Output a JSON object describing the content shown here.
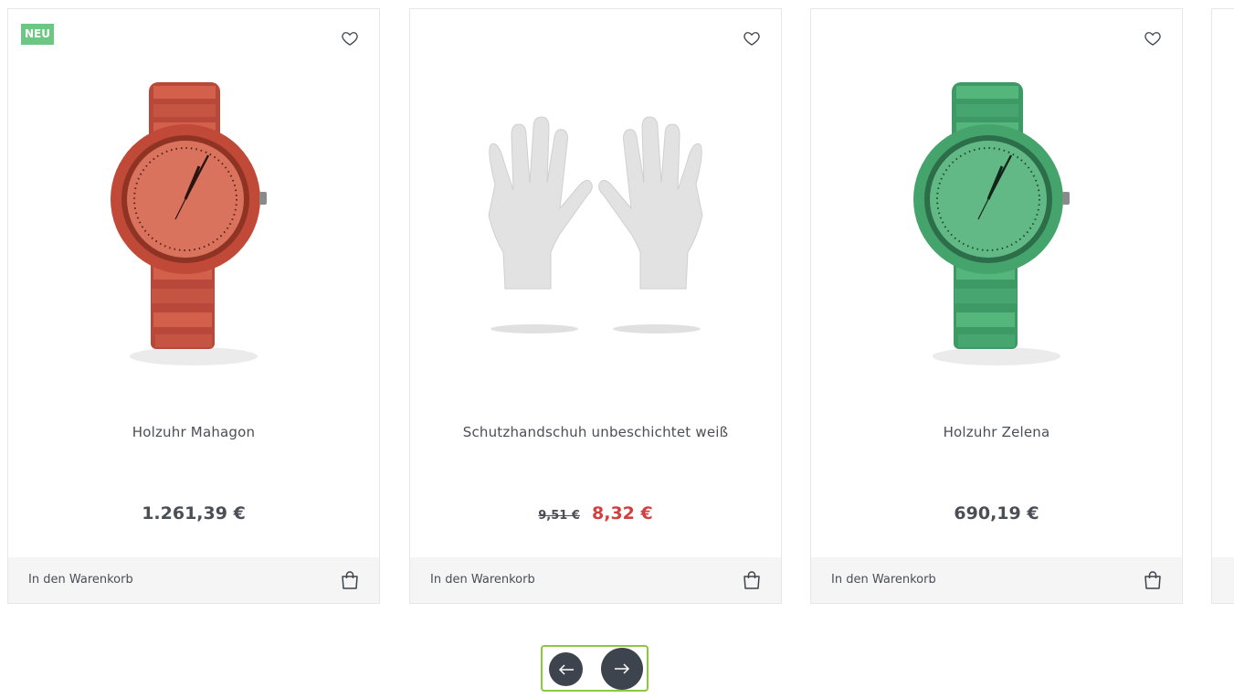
{
  "products": [
    {
      "badge": "NEU",
      "name": "Holzuhr Mahagon",
      "price": "1.261,39 €",
      "cart_label": "In den Warenkorb",
      "image": "watch-mahogany",
      "color": "#c8573f"
    },
    {
      "name": "Schutzhandschuh unbeschichtet weiß",
      "old_price": "9,51 €",
      "sale_price": "8,32 €",
      "cart_label": "In den Warenkorb",
      "image": "white-gloves",
      "color": "#e5e5e5"
    },
    {
      "name": "Holzuhr Zelena",
      "price": "690,19 €",
      "cart_label": "In den Warenkorb",
      "image": "watch-green",
      "color": "#4caa74"
    }
  ],
  "colors": {
    "badge": "#6cc783",
    "sale": "#d13f3f",
    "nav_button": "#3e444d",
    "focus_ring": "#8dc63f"
  },
  "icons": {
    "wishlist": "heart-icon",
    "cart": "shopping-bag-icon",
    "prev": "arrow-left-icon",
    "next": "arrow-right-icon"
  }
}
